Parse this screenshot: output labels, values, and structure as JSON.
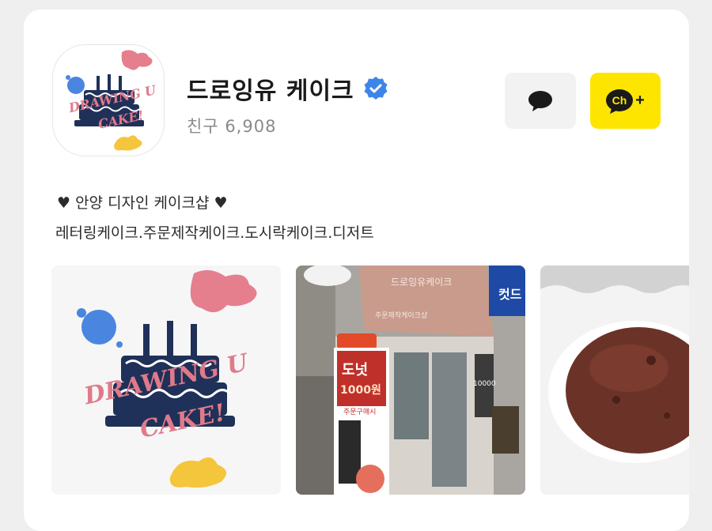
{
  "profile": {
    "name": "드로잉유 케이크",
    "friends_label": "친구 6,908",
    "verified_icon": "verified-badge-icon",
    "logo_text_line1": "DRAWING U",
    "logo_text_line2": "CAKE!"
  },
  "buttons": {
    "chat_icon": "chat-bubble-icon",
    "channel_add_label": "Ch",
    "channel_add_plus": "+"
  },
  "description": {
    "line1": "♥ 안양 디자인 케이크샵 ♥",
    "line2": "레터링케이크.주문제작케이크.도시락케이크.디저트"
  },
  "gallery": {
    "storefront_sign": "드로잉유케이크",
    "storefront_subsign": "주문제작케이크샵",
    "poster_title": "도넛",
    "poster_price": "1000원",
    "poster_sub": "주문구매시",
    "side_sign": "컷드",
    "stand_text": "10000"
  },
  "colors": {
    "accent_yellow": "#fee500",
    "verified_blue": "#3d86e8",
    "cake_navy": "#1f3159",
    "cake_pink": "#e07a8a"
  }
}
